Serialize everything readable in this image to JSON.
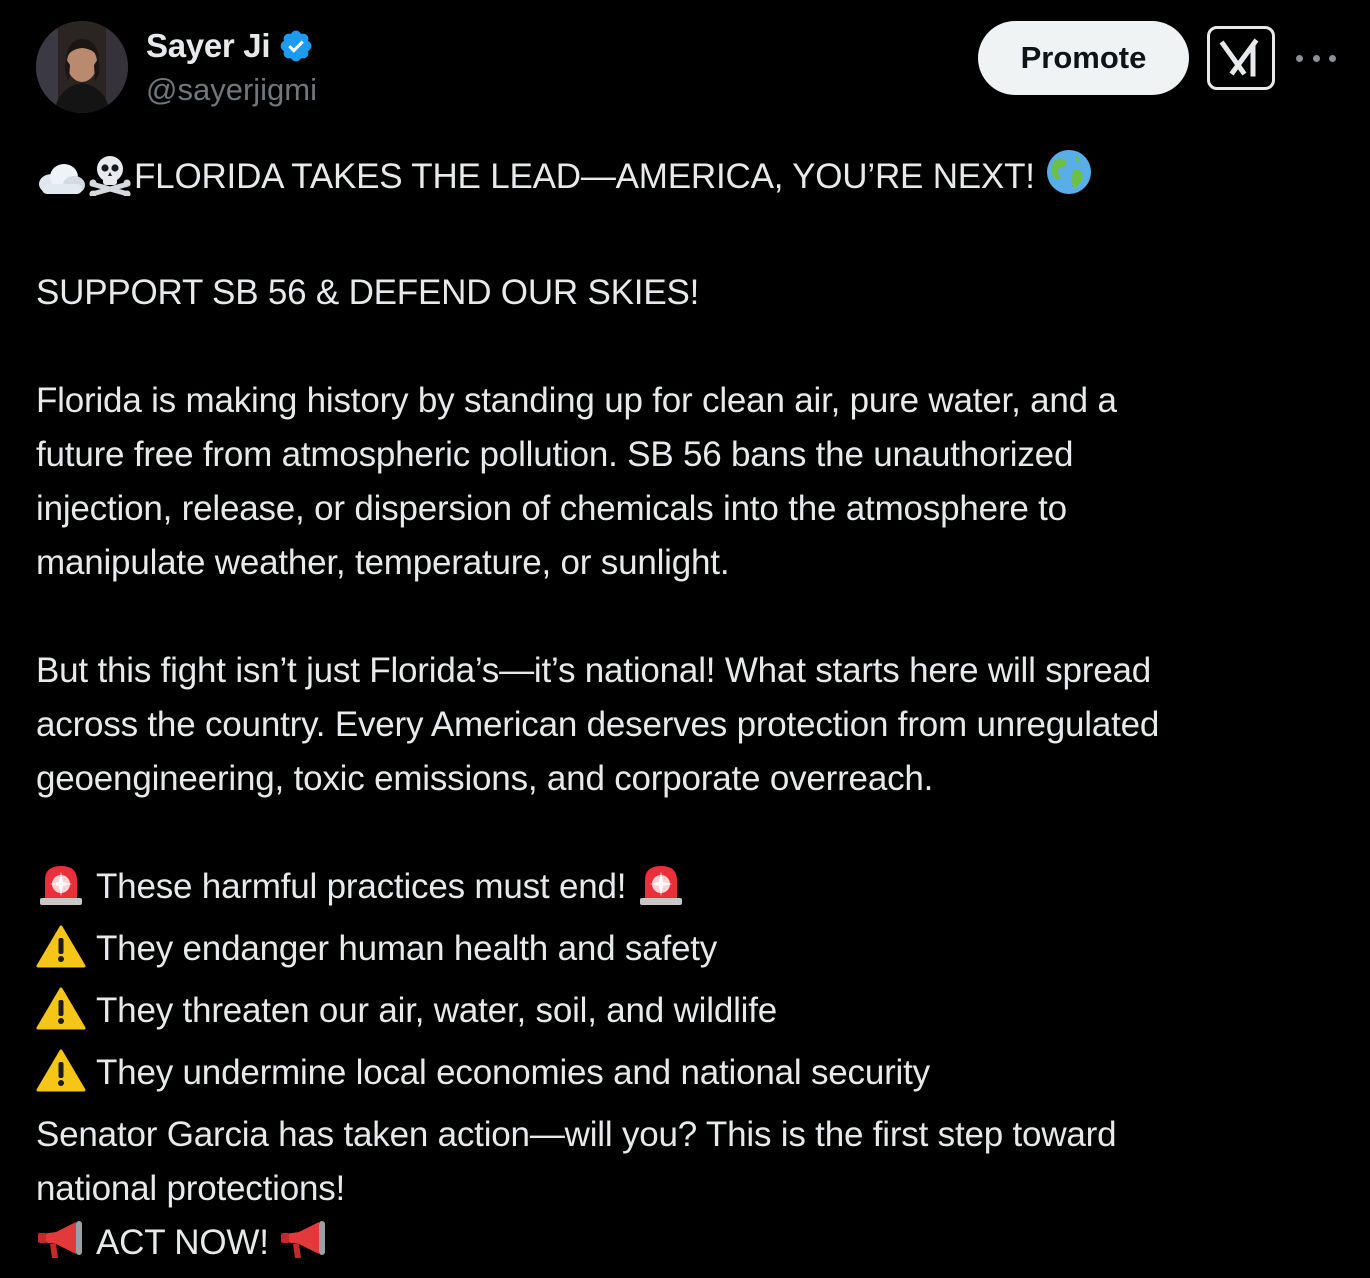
{
  "author": {
    "name": "Sayer Ji",
    "handle": "@sayerjigmi",
    "verified": true,
    "verified_color": "#1d9bf0"
  },
  "actions": {
    "promote_label": "Promote",
    "grok_icon": "grok-icon",
    "more_icon": "more-options-icon"
  },
  "post": {
    "headline": "FLORIDA TAKES THE LEAD—AMERICA, YOU’RE NEXT!",
    "headline_icons": [
      "cloud-icon",
      "skull-crossbones-icon",
      "globe-icon"
    ],
    "subhead": "SUPPORT SB 56 & DEFEND OUR SKIES!",
    "paragraph1_lines": [
      "Florida is making history by standing up for clean air, pure water, and a",
      "future free from atmospheric pollution. SB 56 bans the unauthorized",
      "injection, release, or dispersion of chemicals into the atmosphere to",
      "manipulate weather, temperature, or sunlight."
    ],
    "paragraph2_lines": [
      "But this fight isn’t just Florida’s—it’s national! What starts here will spread",
      "across the country. Every American deserves protection from unregulated",
      "geoengineering, toxic emissions, and corporate overreach."
    ],
    "alarm_line": "These harmful practices must end!",
    "warnings": [
      "They endanger human health and safety",
      "They threaten our air, water, soil, and wildlife",
      "They undermine local economies and national security"
    ],
    "closing_lines": [
      "Senator Garcia has taken action—will you? This is the first step toward",
      "national protections!"
    ],
    "cta": "ACT NOW!"
  },
  "colors": {
    "background": "#000000",
    "text": "#e7e9ea",
    "secondary_text": "#71767b",
    "promote_bg": "#eff3f4"
  }
}
